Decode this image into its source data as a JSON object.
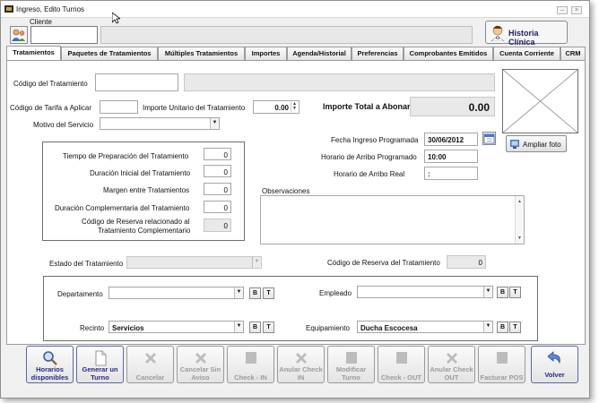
{
  "window": {
    "title": "Ingreso, Edito Turnos"
  },
  "cliente": {
    "label": "Cliente",
    "value": "",
    "name": ""
  },
  "historia_clinica": {
    "label": "Historia Clínica"
  },
  "tabs": [
    {
      "label": "Tratamientos"
    },
    {
      "label": "Paquetes de Tratamientos"
    },
    {
      "label": "Múltiples Tratamientos"
    },
    {
      "label": "Importes"
    },
    {
      "label": "Agenda/Historial"
    },
    {
      "label": "Preferencias"
    },
    {
      "label": "Comprobantes Emitidos"
    },
    {
      "label": "Cuenta Corriente"
    },
    {
      "label": "CRM"
    }
  ],
  "tratamiento": {
    "codigo_label": "Código del Tratamiento",
    "codigo_value": "",
    "nombre_value": "",
    "tarifa_label": "Código de Tarifa a Aplicar",
    "tarifa_value": "",
    "importe_unitario_label": "Importe Unitario del Tratamiento",
    "importe_unitario_value": "0.00",
    "motivo_label": "Motivo del Servicio",
    "motivo_value": "",
    "importe_total_label": "Importe Total a Abonar",
    "importe_total_value": "0.00"
  },
  "tiempos": {
    "preparacion_label": "Tiempo de Preparación del Tratamiento",
    "preparacion_value": "0",
    "duracion_label": "Duración Inicial del Tratamiento",
    "duracion_value": "0",
    "margen_label": "Margen entre Tratamientos",
    "margen_value": "0",
    "complementaria_label": "Duración Complementaria del Tratamiento",
    "complementaria_value": "0",
    "reserva_label_1": "Código de Reserva relacionado al",
    "reserva_label_2": "Tratamiento Complementario",
    "reserva_value": "0"
  },
  "fechas": {
    "fecha_label": "Fecha Ingreso Programada",
    "fecha_value": "30/06/2012",
    "horario_prog_label": "Horario de Arribo Programado",
    "horario_prog_value": "10:00",
    "horario_real_label": "Horario de Arribo Real",
    "horario_real_value": " :"
  },
  "foto": {
    "ampliar_label": "Ampliar foto"
  },
  "observaciones": {
    "label": "Observaciones",
    "value": ""
  },
  "estado": {
    "label": "Estado del Tratamiento",
    "value": "",
    "reserva_label": "Código de Reserva del Tratamiento",
    "reserva_value": "0"
  },
  "asignacion": {
    "departamento_label": "Departamento",
    "departamento_value": "",
    "empleado_label": "Empleado",
    "empleado_value": "",
    "recinto_label": "Recinto",
    "recinto_value": "Servicios",
    "equipamiento_label": "Equipamiento",
    "equipamiento_value": "Ducha Escocesa",
    "b_label": "B",
    "t_label": "T"
  },
  "footer": [
    {
      "line1": "Horarios",
      "line2": "disponibles",
      "enabled": true
    },
    {
      "line1": "Generar un",
      "line2": "Turno",
      "enabled": true
    },
    {
      "line1": "Cancelar",
      "line2": "",
      "enabled": false
    },
    {
      "line1": "Cancelar Sin",
      "line2": "Aviso",
      "enabled": false
    },
    {
      "line1": "Check - IN",
      "line2": "",
      "enabled": false
    },
    {
      "line1": "Anular Check",
      "line2": "IN",
      "enabled": false
    },
    {
      "line1": "Modificar",
      "line2": "Turno",
      "enabled": false
    },
    {
      "line1": "Check - OUT",
      "line2": "",
      "enabled": false
    },
    {
      "line1": "Anular Check",
      "line2": "OUT",
      "enabled": false
    },
    {
      "line1": "Facturar POS",
      "line2": "",
      "enabled": false
    },
    {
      "line1": "Volver",
      "line2": "",
      "enabled": true
    }
  ],
  "colors": {
    "accent_text": "#232a88",
    "disabled_text": "#9a9a9a",
    "window_bg": "#f0f0f0"
  },
  "icons": [
    "app-icon",
    "user-icon",
    "doctor-icon",
    "calendar-icon",
    "photo-icon",
    "magnifier-icon",
    "document-icon",
    "cross-icon",
    "check-square-icon",
    "back-arrow-icon"
  ]
}
